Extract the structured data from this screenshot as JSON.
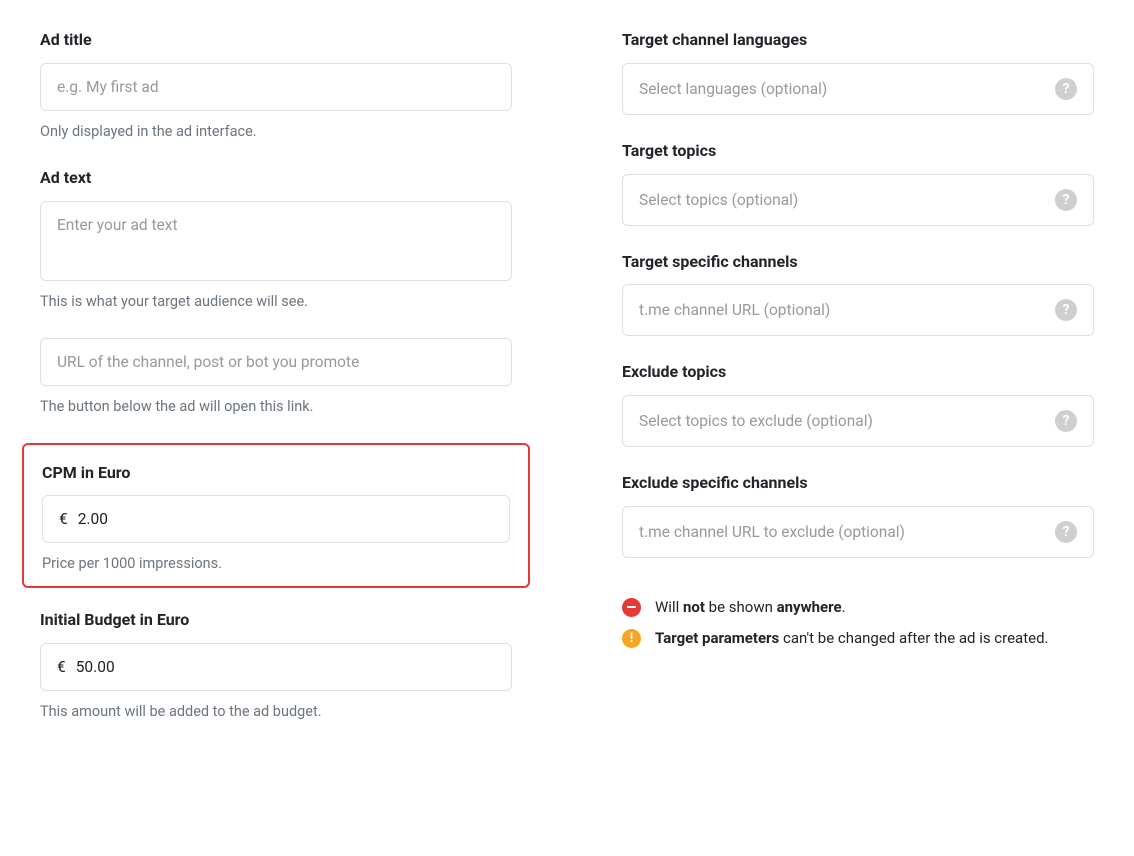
{
  "left": {
    "adTitle": {
      "label": "Ad title",
      "placeholder": "e.g. My first ad",
      "help": "Only displayed in the ad interface."
    },
    "adText": {
      "label": "Ad text",
      "placeholder": "Enter your ad text",
      "help": "This is what your target audience will see."
    },
    "url": {
      "placeholder": "URL of the channel, post or bot you promote",
      "help": "The button below the ad will open this link."
    },
    "cpm": {
      "label": "CPM in Euro",
      "currency": "€",
      "value": "2.00",
      "help": "Price per 1000 impressions."
    },
    "budget": {
      "label": "Initial Budget in Euro",
      "currency": "€",
      "value": "50.00",
      "help": "This amount will be added to the ad budget."
    }
  },
  "right": {
    "languages": {
      "label": "Target channel languages",
      "placeholder": "Select languages (optional)"
    },
    "topics": {
      "label": "Target topics",
      "placeholder": "Select topics (optional)"
    },
    "channels": {
      "label": "Target specific channels",
      "placeholder": "t.me channel URL (optional)"
    },
    "exTopics": {
      "label": "Exclude topics",
      "placeholder": "Select topics to exclude (optional)"
    },
    "exChannels": {
      "label": "Exclude specific channels",
      "placeholder": "t.me channel URL to exclude (optional)"
    }
  },
  "notes": {
    "n1": {
      "pre": "Will ",
      "b1": "not",
      "mid": " be shown ",
      "b2": "anywhere",
      "post": "."
    },
    "n2": {
      "b1": "Target parameters",
      "post": " can't be changed after the ad is created."
    }
  }
}
